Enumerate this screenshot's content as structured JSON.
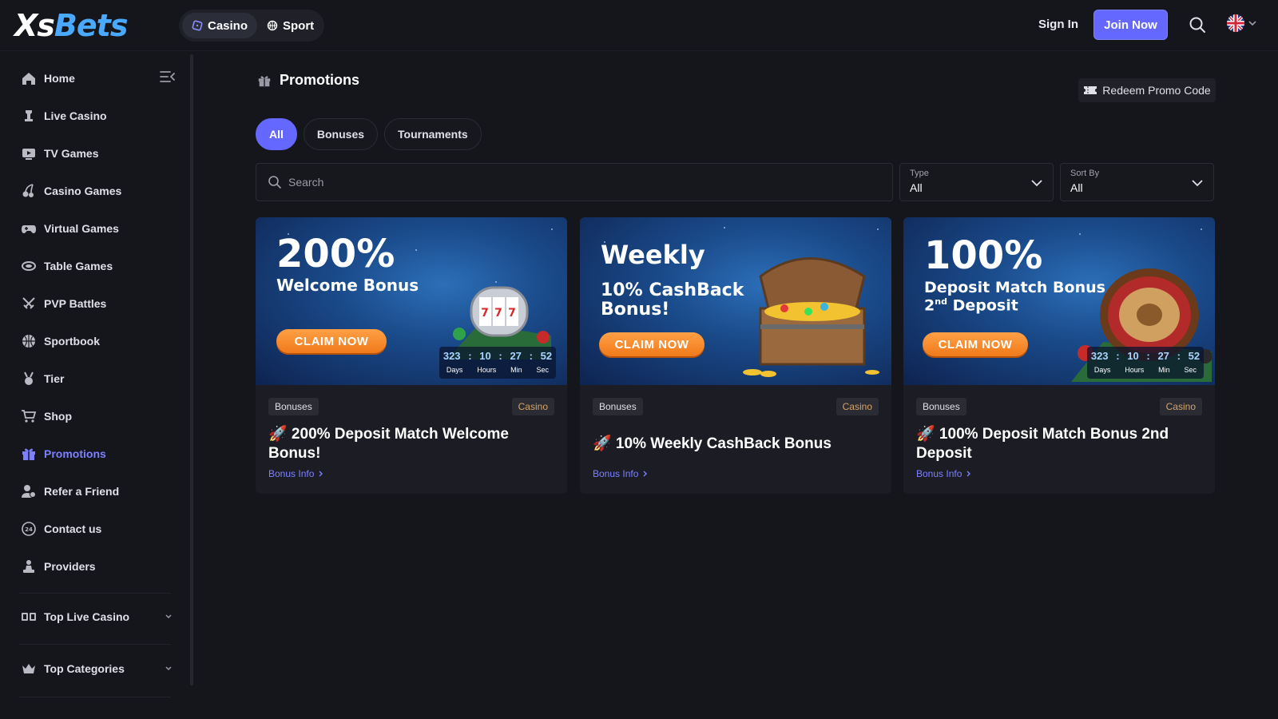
{
  "header": {
    "logo_xs": "Xs",
    "logo_bets": "Bets",
    "modes": [
      {
        "label": "Casino",
        "icon": "dice-icon"
      },
      {
        "label": "Sport",
        "icon": "basketball-icon"
      }
    ],
    "sign_in": "Sign In",
    "join_now": "Join Now"
  },
  "sidebar": {
    "items": [
      {
        "label": "Home",
        "icon": "home-icon"
      },
      {
        "label": "Live Casino",
        "icon": "chess-piece-icon"
      },
      {
        "label": "TV Games",
        "icon": "tv-play-icon"
      },
      {
        "label": "Casino Games",
        "icon": "cherries-icon"
      },
      {
        "label": "Virtual Games",
        "icon": "gamepad-icon"
      },
      {
        "label": "Table Games",
        "icon": "table-icon"
      },
      {
        "label": "PVP Battles",
        "icon": "swords-icon"
      },
      {
        "label": "Sportbook",
        "icon": "basketball-icon"
      },
      {
        "label": "Tier",
        "icon": "medal-icon"
      },
      {
        "label": "Shop",
        "icon": "cart-icon"
      },
      {
        "label": "Promotions",
        "icon": "gift-icon"
      },
      {
        "label": "Refer a Friend",
        "icon": "user-plus-icon"
      },
      {
        "label": "Contact us",
        "icon": "support-24-icon"
      },
      {
        "label": "Providers",
        "icon": "pawn-icon"
      }
    ],
    "active": "Promotions",
    "sections": [
      {
        "label": "Top Live Casino",
        "icon": "cards-icon"
      },
      {
        "label": "Top Categories",
        "icon": "crown-icon"
      }
    ]
  },
  "main": {
    "title": "Promotions",
    "redeem": "Redeem Promo Code",
    "tabs": [
      "All",
      "Bonuses",
      "Tournaments"
    ],
    "active_tab": "All",
    "search_placeholder": "Search",
    "type_filter": {
      "label": "Type",
      "value": "All"
    },
    "sort_filter": {
      "label": "Sort By",
      "value": "All"
    }
  },
  "cards": [
    {
      "banner_big": "200%",
      "banner_sub": "Welcome Bonus",
      "claim": "CLAIM NOW",
      "timer": {
        "days": "323",
        "hours": "10",
        "min": "27",
        "sec": "52"
      },
      "timer_units": [
        "Days",
        "Hours",
        "Min",
        "Sec"
      ],
      "category": "Bonuses",
      "tag": "Casino",
      "title": "🚀 200% Deposit Match Welcome Bonus!",
      "info": "Bonus Info"
    },
    {
      "banner_big": "Weekly",
      "banner_sub": "10% CashBack Bonus!",
      "claim": "CLAIM NOW",
      "category": "Bonuses",
      "tag": "Casino",
      "title": "🚀 10% Weekly CashBack Bonus",
      "info": "Bonus Info"
    },
    {
      "banner_big": "100%",
      "banner_sub": "Deposit Match Bonus",
      "banner_sub2_num": "2",
      "banner_sub2_sup": "nd",
      "banner_sub2_rest": " Deposit",
      "claim": "CLAIM NOW",
      "timer": {
        "days": "323",
        "hours": "10",
        "min": "27",
        "sec": "52"
      },
      "timer_units": [
        "Days",
        "Hours",
        "Min",
        "Sec"
      ],
      "category": "Bonuses",
      "tag": "Casino",
      "title": "🚀 100% Deposit Match Bonus 2nd Deposit",
      "info": "Bonus Info"
    }
  ],
  "colors": {
    "accent": "#6468ff",
    "background": "#15161c",
    "card": "#1c1d24",
    "claim_orange": "#f58a2a",
    "casino_tag": "#d5a56a"
  }
}
